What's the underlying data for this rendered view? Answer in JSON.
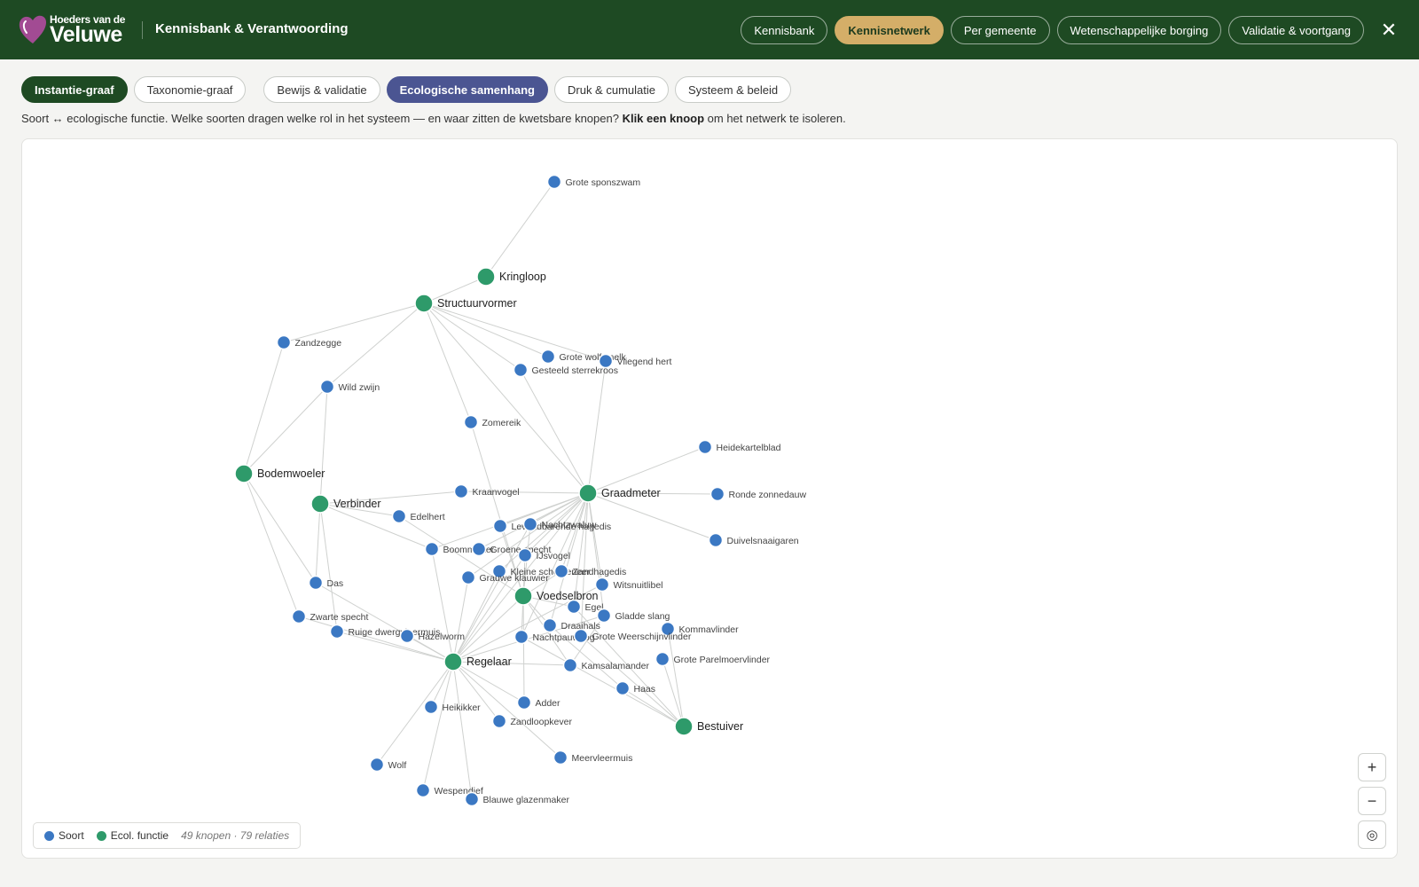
{
  "app": {
    "logo_small": "Hoeders van de",
    "logo_big": "Veluwe",
    "title": "Kennisbank & Verantwoording",
    "close_symbol": "✕"
  },
  "nav": [
    {
      "label": "Kennisbank",
      "active": false
    },
    {
      "label": "Kennisnetwerk",
      "active": true
    },
    {
      "label": "Per gemeente",
      "active": false
    },
    {
      "label": "Wetenschappelijke borging",
      "active": false
    },
    {
      "label": "Validatie & voortgang",
      "active": false
    }
  ],
  "tabs": [
    {
      "label": "Instantie-graaf",
      "state": "active-green"
    },
    {
      "label": "Taxonomie-graaf",
      "state": ""
    },
    {
      "label": "Bewijs & validatie",
      "state": "gap"
    },
    {
      "label": "Ecologische samenhang",
      "state": "active-blue"
    },
    {
      "label": "Druk & cumulatie",
      "state": ""
    },
    {
      "label": "Systeem & beleid",
      "state": ""
    }
  ],
  "description": {
    "text_before": "Soort ↔ ecologische functie. Welke soorten dragen welke rol in het systeem — en waar zitten de kwetsbare knopen? ",
    "bold": "Klik een knoop",
    "text_after": " om het netwerk te isoleren."
  },
  "zoom": {
    "in": "+",
    "out": "−",
    "reset": "◎"
  },
  "legend": {
    "species_label": "Soort",
    "function_label": "Ecol. functie",
    "counts": "49 knopen · 79 relaties"
  },
  "colors": {
    "brand_green": "#1e4a23",
    "accent_gold": "#d4ae68",
    "active_tab_blue": "#4b5592",
    "species_node": "#3b78c3",
    "function_node": "#2e9a6a",
    "edge": "#cfd1cf",
    "logo_heart": "#a24b93"
  },
  "icons": {
    "logo": "heart-logo-icon",
    "close": "close-icon",
    "zoom_in": "plus-icon",
    "zoom_out": "minus-icon",
    "reset": "target-icon"
  },
  "graph": {
    "functions": [
      {
        "id": "kringloop",
        "label": "Kringloop"
      },
      {
        "id": "structuurvormer",
        "label": "Structuurvormer"
      },
      {
        "id": "bodemwoeler",
        "label": "Bodemwoeler"
      },
      {
        "id": "verbinder",
        "label": "Verbinder"
      },
      {
        "id": "graadmeter",
        "label": "Graadmeter"
      },
      {
        "id": "voedselbron",
        "label": "Voedselbron"
      },
      {
        "id": "regelaar",
        "label": "Regelaar"
      },
      {
        "id": "bestuiver",
        "label": "Bestuiver"
      }
    ],
    "species": [
      {
        "id": "grote-sponszwam",
        "label": "Grote sponszwam"
      },
      {
        "id": "zandzegge",
        "label": "Zandzegge"
      },
      {
        "id": "wild-zwijn",
        "label": "Wild zwijn"
      },
      {
        "id": "grote-wolfsmelk",
        "label": "Grote wolfsmelk"
      },
      {
        "id": "vliegend-hert",
        "label": "Vliegend hert"
      },
      {
        "id": "gesteeld-sterrekroos",
        "label": "Gesteeld sterrekroos"
      },
      {
        "id": "zomereik",
        "label": "Zomereik"
      },
      {
        "id": "heidekartelblad",
        "label": "Heidekartelblad"
      },
      {
        "id": "kraanvogel",
        "label": "Kraanvogel"
      },
      {
        "id": "ronde-zonnedauw",
        "label": "Ronde zonnedauw"
      },
      {
        "id": "edelhert",
        "label": "Edelhert"
      },
      {
        "id": "levendbarende-hagedis",
        "label": "Levendbarende hagedis"
      },
      {
        "id": "nachtzwaluw",
        "label": "Nachtzwaluw"
      },
      {
        "id": "duivelsnaaigaren",
        "label": "Duivelsnaaigaren"
      },
      {
        "id": "boommarter",
        "label": "Boommarter"
      },
      {
        "id": "groene-specht",
        "label": "Groene specht"
      },
      {
        "id": "ijsvogel",
        "label": "IJsvogel"
      },
      {
        "id": "kleine-schorseneer",
        "label": "Kleine schorseneer"
      },
      {
        "id": "zandhagedis",
        "label": "Zandhagedis"
      },
      {
        "id": "grauwe-klauwier",
        "label": "Grauwe klauwier"
      },
      {
        "id": "witsnuitlibel",
        "label": "Witsnuitlibel"
      },
      {
        "id": "das",
        "label": "Das"
      },
      {
        "id": "egel",
        "label": "Egel"
      },
      {
        "id": "gladde-slang",
        "label": "Gladde slang"
      },
      {
        "id": "zwarte-specht",
        "label": "Zwarte specht"
      },
      {
        "id": "draaihals",
        "label": "Draaihals"
      },
      {
        "id": "kommavlinder",
        "label": "Kommavlinder"
      },
      {
        "id": "ruige-dwergvleermuis",
        "label": "Ruige dwergvleermuis"
      },
      {
        "id": "hazelworm",
        "label": "Hazelworm"
      },
      {
        "id": "nachtpauwoog",
        "label": "Nachtpauwoog"
      },
      {
        "id": "grote-weerschijnvlinder",
        "label": "Grote Weerschijnvlinder"
      },
      {
        "id": "grote-parelmoervlinder",
        "label": "Grote Parelmoervlinder"
      },
      {
        "id": "kamsalamander",
        "label": "Kamsalamander"
      },
      {
        "id": "haas",
        "label": "Haas"
      },
      {
        "id": "adder",
        "label": "Adder"
      },
      {
        "id": "heikikker",
        "label": "Heikikker"
      },
      {
        "id": "zandloopkever",
        "label": "Zandloopkever"
      },
      {
        "id": "meervleermuis",
        "label": "Meervleermuis"
      },
      {
        "id": "wolf",
        "label": "Wolf"
      },
      {
        "id": "wespendief",
        "label": "Wespendief"
      },
      {
        "id": "blauwe-glazenmaker",
        "label": "Blauwe glazenmaker"
      }
    ],
    "edges": [
      [
        "grote-sponszwam",
        "kringloop"
      ],
      [
        "kringloop",
        "structuurvormer"
      ],
      [
        "structuurvormer",
        "zandzegge"
      ],
      [
        "structuurvormer",
        "wild-zwijn"
      ],
      [
        "structuurvormer",
        "grote-wolfsmelk"
      ],
      [
        "structuurvormer",
        "gesteeld-sterrekroos"
      ],
      [
        "structuurvormer",
        "vliegend-hert"
      ],
      [
        "structuurvormer",
        "zomereik"
      ],
      [
        "structuurvormer",
        "graadmeter"
      ],
      [
        "zandzegge",
        "bodemwoeler"
      ],
      [
        "wild-zwijn",
        "bodemwoeler"
      ],
      [
        "wild-zwijn",
        "verbinder"
      ],
      [
        "bodemwoeler",
        "das"
      ],
      [
        "bodemwoeler",
        "zwarte-specht"
      ],
      [
        "zomereik",
        "voedselbron"
      ],
      [
        "gesteeld-sterrekroos",
        "graadmeter"
      ],
      [
        "vliegend-hert",
        "graadmeter"
      ],
      [
        "heidekartelblad",
        "graadmeter"
      ],
      [
        "ronde-zonnedauw",
        "graadmeter"
      ],
      [
        "duivelsnaaigaren",
        "graadmeter"
      ],
      [
        "kraanvogel",
        "graadmeter"
      ],
      [
        "verbinder",
        "kraanvogel"
      ],
      [
        "verbinder",
        "edelhert"
      ],
      [
        "verbinder",
        "das"
      ],
      [
        "verbinder",
        "ruige-dwergvleermuis"
      ],
      [
        "verbinder",
        "boommarter"
      ],
      [
        "edelhert",
        "voedselbron"
      ],
      [
        "graadmeter",
        "levendbarende-hagedis"
      ],
      [
        "graadmeter",
        "nachtzwaluw"
      ],
      [
        "graadmeter",
        "boommarter"
      ],
      [
        "graadmeter",
        "groene-specht"
      ],
      [
        "graadmeter",
        "ijsvogel"
      ],
      [
        "graadmeter",
        "kleine-schorseneer"
      ],
      [
        "graadmeter",
        "zandhagedis"
      ],
      [
        "graadmeter",
        "grauwe-klauwier"
      ],
      [
        "graadmeter",
        "witsnuitlibel"
      ],
      [
        "graadmeter",
        "egel"
      ],
      [
        "graadmeter",
        "gladde-slang"
      ],
      [
        "graadmeter",
        "draaihals"
      ],
      [
        "graadmeter",
        "nachtpauwoog"
      ],
      [
        "graadmeter",
        "regelaar"
      ],
      [
        "graadmeter",
        "grote-weerschijnvlinder"
      ],
      [
        "voedselbron",
        "levendbarende-hagedis"
      ],
      [
        "voedselbron",
        "nachtzwaluw"
      ],
      [
        "voedselbron",
        "ijsvogel"
      ],
      [
        "voedselbron",
        "zandhagedis"
      ],
      [
        "voedselbron",
        "egel"
      ],
      [
        "voedselbron",
        "draaihals"
      ],
      [
        "voedselbron",
        "nachtpauwoog"
      ],
      [
        "voedselbron",
        "regelaar"
      ],
      [
        "voedselbron",
        "kamsalamander"
      ],
      [
        "regelaar",
        "boommarter"
      ],
      [
        "regelaar",
        "kleine-schorseneer"
      ],
      [
        "regelaar",
        "grauwe-klauwier"
      ],
      [
        "regelaar",
        "witsnuitlibel"
      ],
      [
        "regelaar",
        "ruige-dwergvleermuis"
      ],
      [
        "regelaar",
        "hazelworm"
      ],
      [
        "regelaar",
        "zwarte-specht"
      ],
      [
        "regelaar",
        "kamsalamander"
      ],
      [
        "regelaar",
        "heikikker"
      ],
      [
        "regelaar",
        "zandloopkever"
      ],
      [
        "regelaar",
        "adder"
      ],
      [
        "regelaar",
        "meervleermuis"
      ],
      [
        "regelaar",
        "wolf"
      ],
      [
        "regelaar",
        "wespendief"
      ],
      [
        "regelaar",
        "blauwe-glazenmaker"
      ],
      [
        "regelaar",
        "gladde-slang"
      ],
      [
        "regelaar",
        "nachtzwaluw"
      ],
      [
        "regelaar",
        "ijsvogel"
      ],
      [
        "regelaar",
        "das"
      ],
      [
        "bestuiver",
        "grote-parelmoervlinder"
      ],
      [
        "bestuiver",
        "kommavlinder"
      ],
      [
        "bestuiver",
        "haas"
      ],
      [
        "bestuiver",
        "grote-weerschijnvlinder"
      ],
      [
        "bestuiver",
        "nachtpauwoog"
      ],
      [
        "bestuiver",
        "egel"
      ],
      [
        "kamsalamander",
        "gladde-slang"
      ],
      [
        "haas",
        "draaihals"
      ],
      [
        "adder",
        "voedselbron"
      ]
    ]
  }
}
